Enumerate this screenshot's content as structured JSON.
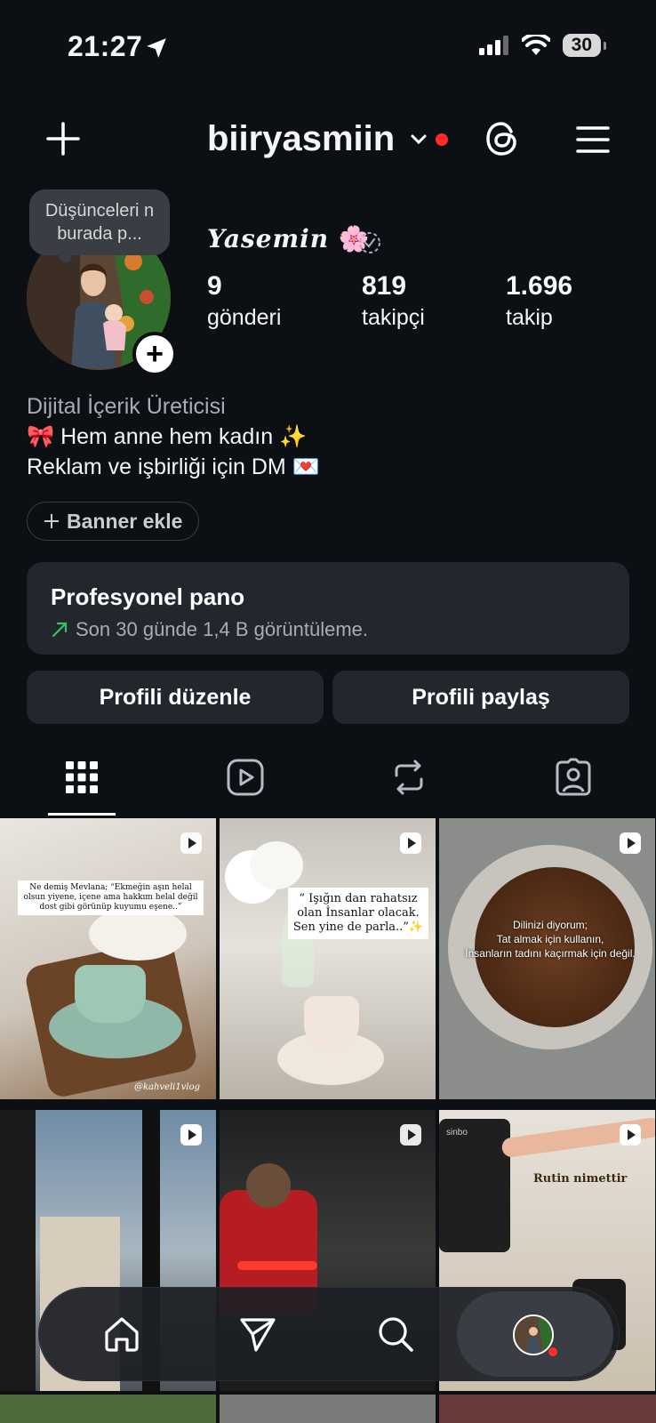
{
  "status_bar": {
    "time": "21:27",
    "battery": "30"
  },
  "header": {
    "username": "biiryasmiin"
  },
  "profile": {
    "note": "Düşünceleri n burada p...",
    "display_name": "Yasemin",
    "name_emoji": "🌸",
    "stats": [
      {
        "value": "9",
        "label": "gönderi"
      },
      {
        "value": "819",
        "label": "takipçi"
      },
      {
        "value": "1.696",
        "label": "takip"
      }
    ],
    "category": "Dijital İçerik Üreticisi",
    "bio_line1": "🎀 Hem anne hem kadın ✨",
    "bio_line2": "Reklam ve işbirliği için DM 💌",
    "banner_button": "Banner ekle"
  },
  "dashboard": {
    "title": "Profesyonel pano",
    "subtitle": "Son 30 günde 1,4 B görüntüleme."
  },
  "buttons": {
    "edit": "Profili düzenle",
    "share": "Profili paylaş"
  },
  "tabs": [
    "grid-icon",
    "reels-icon",
    "reposts-icon",
    "tagged-icon"
  ],
  "posts": [
    {
      "caption": "Ne demiş Mevlana;\n“Ekmeğin aşın helal olsun yiyene, içene ama hakkım helal değil dost gibi görünüp kuyumu eşene..”",
      "watermark": "@kahveli1vlog"
    },
    {
      "caption": "“ Işığın dan rahatsız olan İnsanlar olacak. Sen yine de parla..”✨"
    },
    {
      "caption": "Dilinizi diyorum;\nTat almak için kullanın,\nİnsanların tadını kaçırmak için değil."
    },
    {
      "caption": ""
    },
    {
      "caption": ""
    },
    {
      "caption": "Rutin nimettir",
      "brand": "sinbo"
    }
  ],
  "nav": [
    "home-icon",
    "send-icon",
    "search-icon",
    "profile-avatar"
  ],
  "colors": {
    "background": "#0c0f14",
    "card": "#23262d",
    "notification": "#ff2b2b",
    "trend_green": "#35c26b"
  }
}
